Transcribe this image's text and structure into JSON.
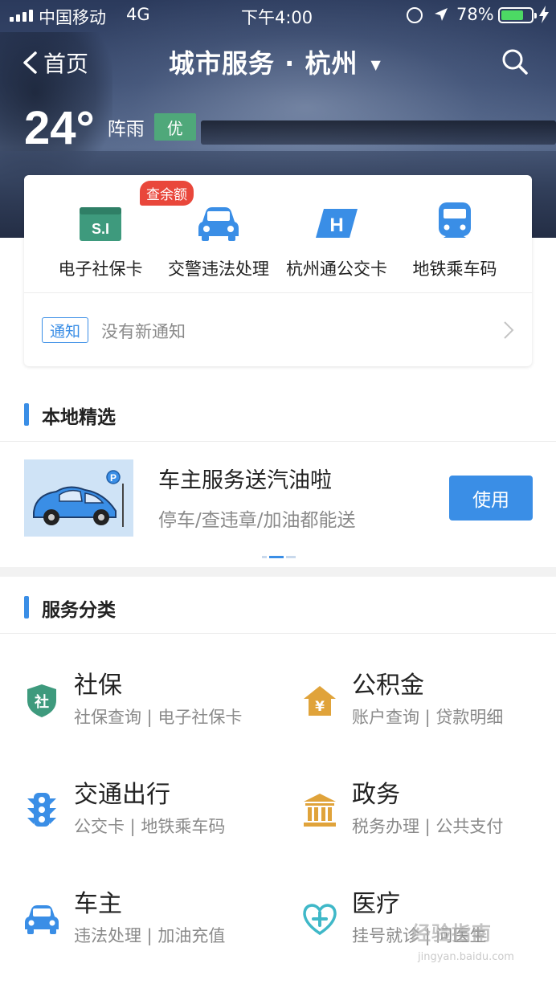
{
  "status_bar": {
    "carrier": "中国移动",
    "network": "4G",
    "time": "下午4:00",
    "battery_percent": "78%",
    "battery_level": 0.78,
    "battery_color": "#4cd964"
  },
  "nav": {
    "back_label": "首页",
    "title": "城市服务 · 杭州",
    "caret": "▼"
  },
  "weather": {
    "temperature": "24°",
    "condition": "阵雨",
    "air_quality": "优",
    "air_quality_color": "#4fa87a"
  },
  "quick_services": [
    {
      "label": "电子社保卡",
      "icon": "si-card-icon",
      "badge": "查余额"
    },
    {
      "label": "交警违法处理",
      "icon": "car-icon"
    },
    {
      "label": "杭州通公交卡",
      "icon": "h-card-icon"
    },
    {
      "label": "地铁乘车码",
      "icon": "metro-icon"
    }
  ],
  "notice": {
    "tag": "通知",
    "text": "没有新通知"
  },
  "local_picks": {
    "header": "本地精选",
    "promo_title": "车主服务送汽油啦",
    "promo_subtitle": "停车/查违章/加油都能送",
    "use_button": "使用",
    "pic_letter": "P"
  },
  "categories": {
    "header": "服务分类",
    "items": [
      {
        "name": "社保",
        "desc": "社保查询 | 电子社保卡",
        "icon": "shield-icon",
        "icon_text": "社",
        "color": "#3e9a7d"
      },
      {
        "name": "公积金",
        "desc": "账户查询 | 贷款明细",
        "icon": "house-icon",
        "icon_text": "¥",
        "color": "#e0a33a"
      },
      {
        "name": "交通出行",
        "desc": "公交卡 | 地铁乘车码",
        "icon": "traffic-light-icon",
        "color": "#3a8ee6"
      },
      {
        "name": "政务",
        "desc": "税务办理 | 公共支付",
        "icon": "government-building-icon",
        "color": "#e0a33a"
      },
      {
        "name": "车主",
        "desc": "违法处理 | 加油充值",
        "icon": "car-icon",
        "color": "#3a8ee6"
      },
      {
        "name": "医疗",
        "desc": "挂号就诊 | 问医生",
        "icon": "medical-icon",
        "color": "#3fb8c8"
      }
    ]
  },
  "watermark": {
    "text": "经验指南",
    "sub": "jingyan.baidu.com"
  },
  "accent_color": "#3a8ee6",
  "badge_color": "#e9473b"
}
